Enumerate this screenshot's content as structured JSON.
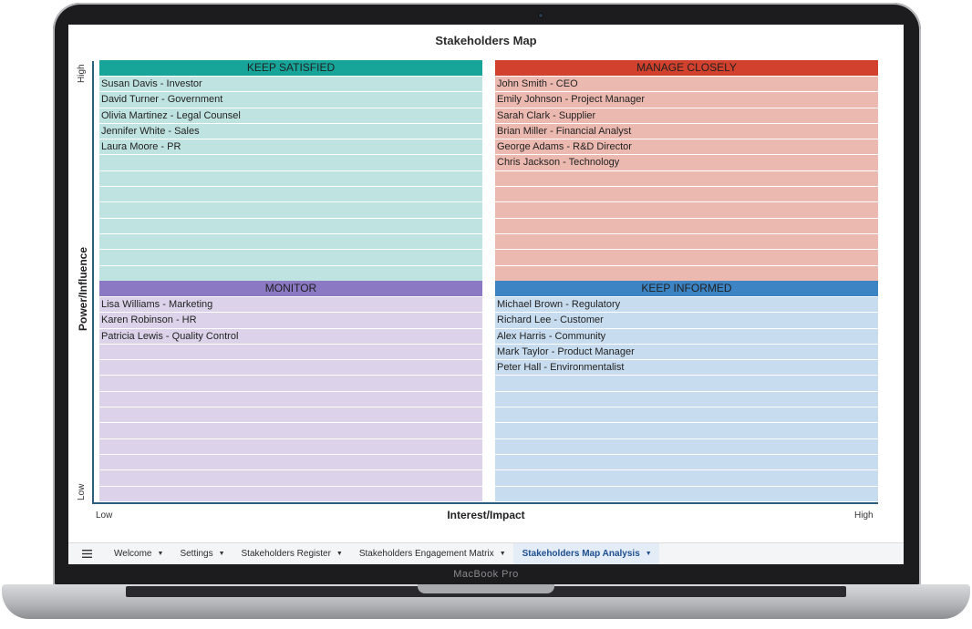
{
  "device_label": "MacBook Pro",
  "map": {
    "title": "Stakeholders Map",
    "y_axis": {
      "title": "Power/Influence",
      "high": "High",
      "low": "Low"
    },
    "x_axis": {
      "title": "Interest/Impact",
      "low": "Low",
      "high": "High"
    },
    "quadrants": {
      "keep_satisfied": {
        "label": "KEEP SATISFIED",
        "color": "#17a59a",
        "items": [
          "Susan Davis - Investor",
          "David Turner - Government",
          "Olivia Martinez - Legal Counsel",
          "Jennifer White - Sales",
          "Laura Moore - PR"
        ]
      },
      "manage_closely": {
        "label": "MANAGE CLOSELY",
        "color": "#d2412d",
        "items": [
          "John Smith - CEO",
          "Emily Johnson - Project Manager",
          "Sarah Clark - Supplier",
          "Brian Miller - Financial Analyst",
          "George Adams - R&D Director",
          "Chris Jackson - Technology"
        ]
      },
      "monitor": {
        "label": "MONITOR",
        "color": "#8b79c4",
        "items": [
          "Lisa Williams - Marketing",
          "Karen Robinson - HR",
          "Patricia Lewis - Quality Control"
        ]
      },
      "keep_informed": {
        "label": "KEEP INFORMED",
        "color": "#3d84c4",
        "items": [
          "Michael Brown - Regulatory",
          "Richard Lee - Customer",
          "Alex Harris - Community",
          "Mark Taylor - Product Manager",
          "Peter Hall - Environmentalist"
        ]
      }
    }
  },
  "tabs": [
    {
      "label": "Welcome",
      "active": false
    },
    {
      "label": "Settings",
      "active": false
    },
    {
      "label": "Stakeholders Register",
      "active": false
    },
    {
      "label": "Stakeholders Engagement Matrix",
      "active": false
    },
    {
      "label": "Stakeholders Map Analysis",
      "active": true
    }
  ],
  "icons": {
    "menu": "hamburger-menu-icon",
    "caret": "caret-down-icon"
  }
}
